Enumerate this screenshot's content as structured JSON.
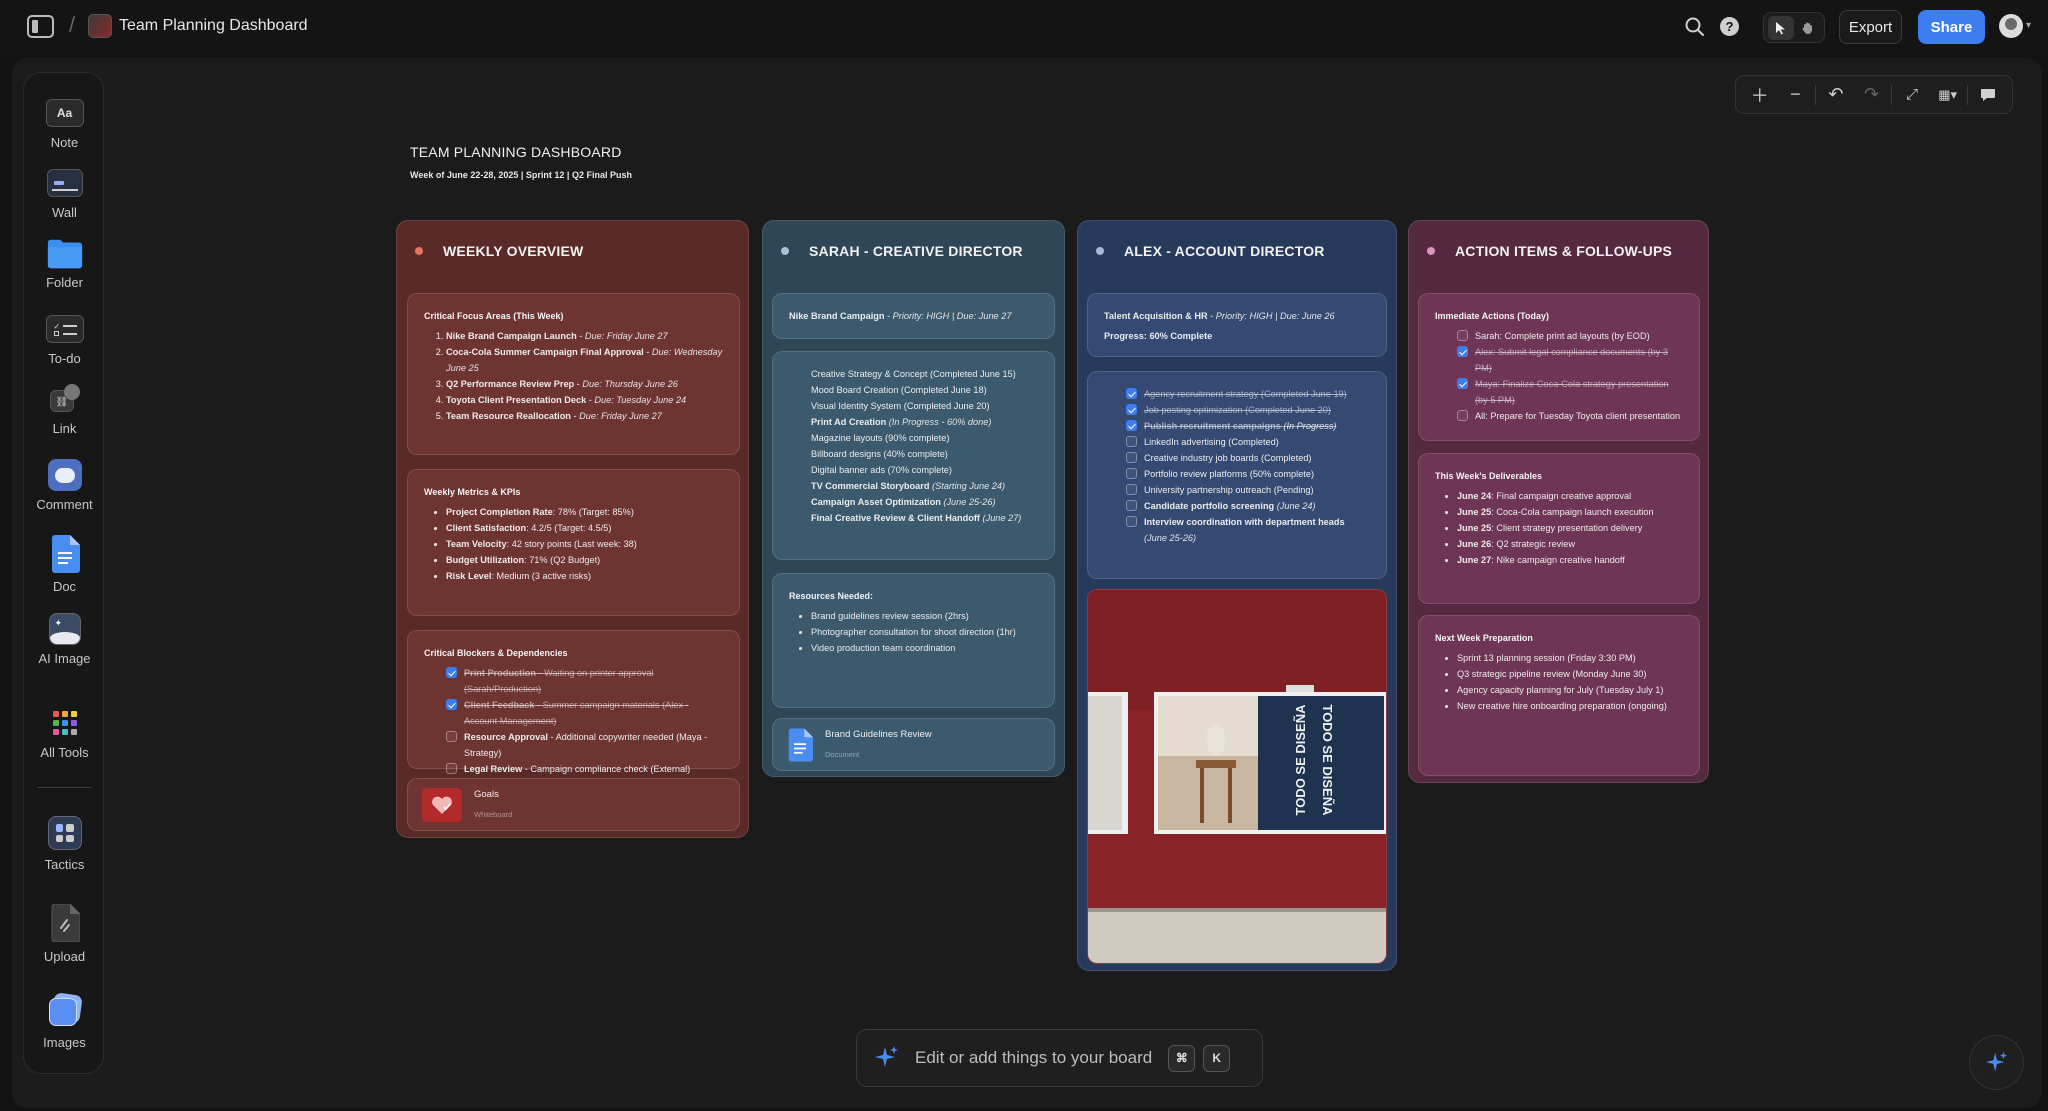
{
  "topbar": {
    "title": "Team Planning Dashboard",
    "export_label": "Export",
    "share_label": "Share"
  },
  "sidebar": {
    "items": [
      {
        "label": "Note",
        "icon": "note-icon",
        "glyph": "Aa"
      },
      {
        "label": "Wall",
        "icon": "wall-icon"
      },
      {
        "label": "Folder",
        "icon": "folder-icon"
      },
      {
        "label": "To-do",
        "icon": "todo-icon"
      },
      {
        "label": "Link",
        "icon": "link-icon"
      },
      {
        "label": "Comment",
        "icon": "comment-icon"
      },
      {
        "label": "Doc",
        "icon": "doc-icon"
      },
      {
        "label": "AI Image",
        "icon": "ai-image-icon"
      },
      {
        "label": "All Tools",
        "icon": "all-tools-icon"
      },
      {
        "label": "Tactics",
        "icon": "tactics-icon"
      },
      {
        "label": "Upload",
        "icon": "upload-icon"
      },
      {
        "label": "Images",
        "icon": "images-icon"
      }
    ]
  },
  "board": {
    "title": "TEAM PLANNING DASHBOARD",
    "subtitle": "Week of June 22-28, 2025 | Sprint 12 | Q2 Final Push"
  },
  "columns": {
    "weekly": {
      "title": "WEEKLY OVERVIEW",
      "focus": {
        "heading": "Critical Focus Areas (This Week)",
        "items": [
          {
            "bold": "Nike Brand Campaign Launch",
            "sep": " - ",
            "due": "Due: Friday June 27"
          },
          {
            "bold": "Coca-Cola Summer Campaign Final Approval",
            "sep": " - ",
            "due": "Due: Wednesday June 25"
          },
          {
            "bold": "Q2 Performance Review Prep",
            "sep": " - ",
            "due": "Due: Thursday June 26"
          },
          {
            "bold": "Toyota Client Presentation Deck",
            "sep": " - ",
            "due": "Due: Tuesday June 24"
          },
          {
            "bold": "Team Resource Reallocation",
            "sep": " - ",
            "due": "Due: Friday June 27"
          }
        ]
      },
      "metrics": {
        "heading": "Weekly Metrics & KPIs",
        "items": [
          {
            "bold": "Project Completion Rate",
            "text": ": 78% (Target: 85%)"
          },
          {
            "bold": "Client Satisfaction",
            "text": ": 4.2/5 (Target: 4.5/5)"
          },
          {
            "bold": "Team Velocity",
            "text": ": 42 story points (Last week: 38)"
          },
          {
            "bold": "Budget Utilization",
            "text": ": 71% (Q2 Budget)"
          },
          {
            "bold": "Risk Level",
            "text": ": Medium (3 active risks)"
          }
        ]
      },
      "blockers": {
        "heading": "Critical Blockers & Dependencies",
        "items": [
          {
            "bold": "Print Production",
            "text": " - Waiting on printer approval (Sarah/Production)",
            "checked": true
          },
          {
            "bold": "Client Feedback",
            "text": " - Summer campaign materials (Alex - Account Management)",
            "checked": true
          },
          {
            "bold": "Resource Approval",
            "text": " - Additional copywriter needed (Maya - Strategy)",
            "checked": false
          },
          {
            "bold": "Legal Review",
            "text": " - Campaign compliance check (External)",
            "checked": false
          }
        ]
      },
      "goals": {
        "name": "Goals",
        "type": "Whiteboard"
      }
    },
    "sarah": {
      "title": "SARAH - CREATIVE DIRECTOR",
      "campaign": {
        "bold": "Nike Brand Campaign",
        "meta": " - Priority: HIGH | Due: June 27"
      },
      "tasks": [
        {
          "text": "Creative Strategy & Concept (Completed June 15)"
        },
        {
          "text": "Mood Board Creation (Completed June 18)"
        },
        {
          "text": "Visual Identity System (Completed June 20)"
        },
        {
          "bold": "Print Ad Creation",
          "ital": "(In Progress - 60% done)"
        },
        {
          "text": "Magazine layouts (90% complete)"
        },
        {
          "text": "Billboard designs (40% complete)"
        },
        {
          "text": "Digital banner ads (70% complete)"
        },
        {
          "bold": "TV Commercial Storyboard",
          "ital": "(Starting June 24)"
        },
        {
          "bold": "Campaign Asset Optimization",
          "ital": "(June 25-26)"
        },
        {
          "bold": "Final Creative Review & Client Handoff",
          "ital": "(June 27)"
        }
      ],
      "resources": {
        "heading": "Resources Needed:",
        "items": [
          "Brand guidelines review session (2hrs)",
          "Photographer consultation for shoot direction (1hr)",
          "Video production team coordination"
        ]
      },
      "doc": {
        "name": "Brand Guidelines Review",
        "type": "Document"
      }
    },
    "alex": {
      "title": "ALEX - ACCOUNT DIRECTOR",
      "talent": {
        "bold": "Talent Acquisition & HR",
        "meta": " - Priority: HIGH | Due: June 26",
        "progress": "Progress: 60% Complete"
      },
      "tasks": [
        {
          "text": "Agency recruitment strategy (Completed June 19)",
          "checked": true,
          "strike": true
        },
        {
          "text": "Job posting optimization (Completed June 20)",
          "checked": true,
          "strike": true
        },
        {
          "bold": "Publish recruitment campaigns",
          "ital": "(In Progress)",
          "checked": true,
          "strike": true
        },
        {
          "text": "LinkedIn advertising (Completed)",
          "checked": false
        },
        {
          "text": "Creative industry job boards (Completed)",
          "checked": false
        },
        {
          "text": "Portfolio review platforms (50% complete)",
          "checked": false
        },
        {
          "text": "University partnership outreach (Pending)",
          "checked": false
        },
        {
          "bold": "Candidate portfolio screening",
          "ital": "(June 24)",
          "checked": false
        },
        {
          "bold": "Interview coordination with department heads",
          "ital": "(June 25-26)",
          "checked": false
        }
      ],
      "image_text": "TODO SE DISEÑA"
    },
    "actions": {
      "title": "ACTION ITEMS & FOLLOW-UPS",
      "immediate": {
        "heading": "Immediate Actions (Today)",
        "items": [
          {
            "text": "Sarah: Complete print ad layouts (by EOD)",
            "checked": false,
            "strike": false
          },
          {
            "text": "Alex: Submit legal compliance documents (by 3 PM)",
            "checked": true,
            "strike": true
          },
          {
            "text": "Maya: Finalize Coca-Cola strategy presentation (by 5 PM)",
            "checked": true,
            "strike": true
          },
          {
            "text": "All: Prepare for Tuesday Toyota client presentation",
            "checked": false,
            "strike": false
          }
        ]
      },
      "deliverables": {
        "heading": "This Week's Deliverables",
        "items": [
          {
            "bold": "June 24",
            "text": ": Final campaign creative approval"
          },
          {
            "bold": "June 25",
            "text": ": Coca-Cola campaign launch execution"
          },
          {
            "bold": "June 25",
            "text": ": Client strategy presentation delivery"
          },
          {
            "bold": "June 26",
            "text": ": Q2 strategic review"
          },
          {
            "bold": "June 27",
            "text": ": Nike campaign creative handoff"
          }
        ]
      },
      "next": {
        "heading": "Next Week Preparation",
        "items": [
          "Sprint 13 planning session (Friday 3:30 PM)",
          "Q3 strategic pipeline review (Monday June 30)",
          "Agency capacity planning for July (Tuesday July 1)",
          "New creative hire onboarding preparation (ongoing)"
        ]
      }
    }
  },
  "ai_bar": {
    "placeholder": "Edit or add things to your board",
    "key1": "⌘",
    "key2": "K"
  },
  "colors": {
    "weekly": "#5a2a28",
    "sarah": "#2e4656",
    "alex": "#283a5c",
    "actions": "#552a40",
    "accent": "#3c7ef0"
  }
}
